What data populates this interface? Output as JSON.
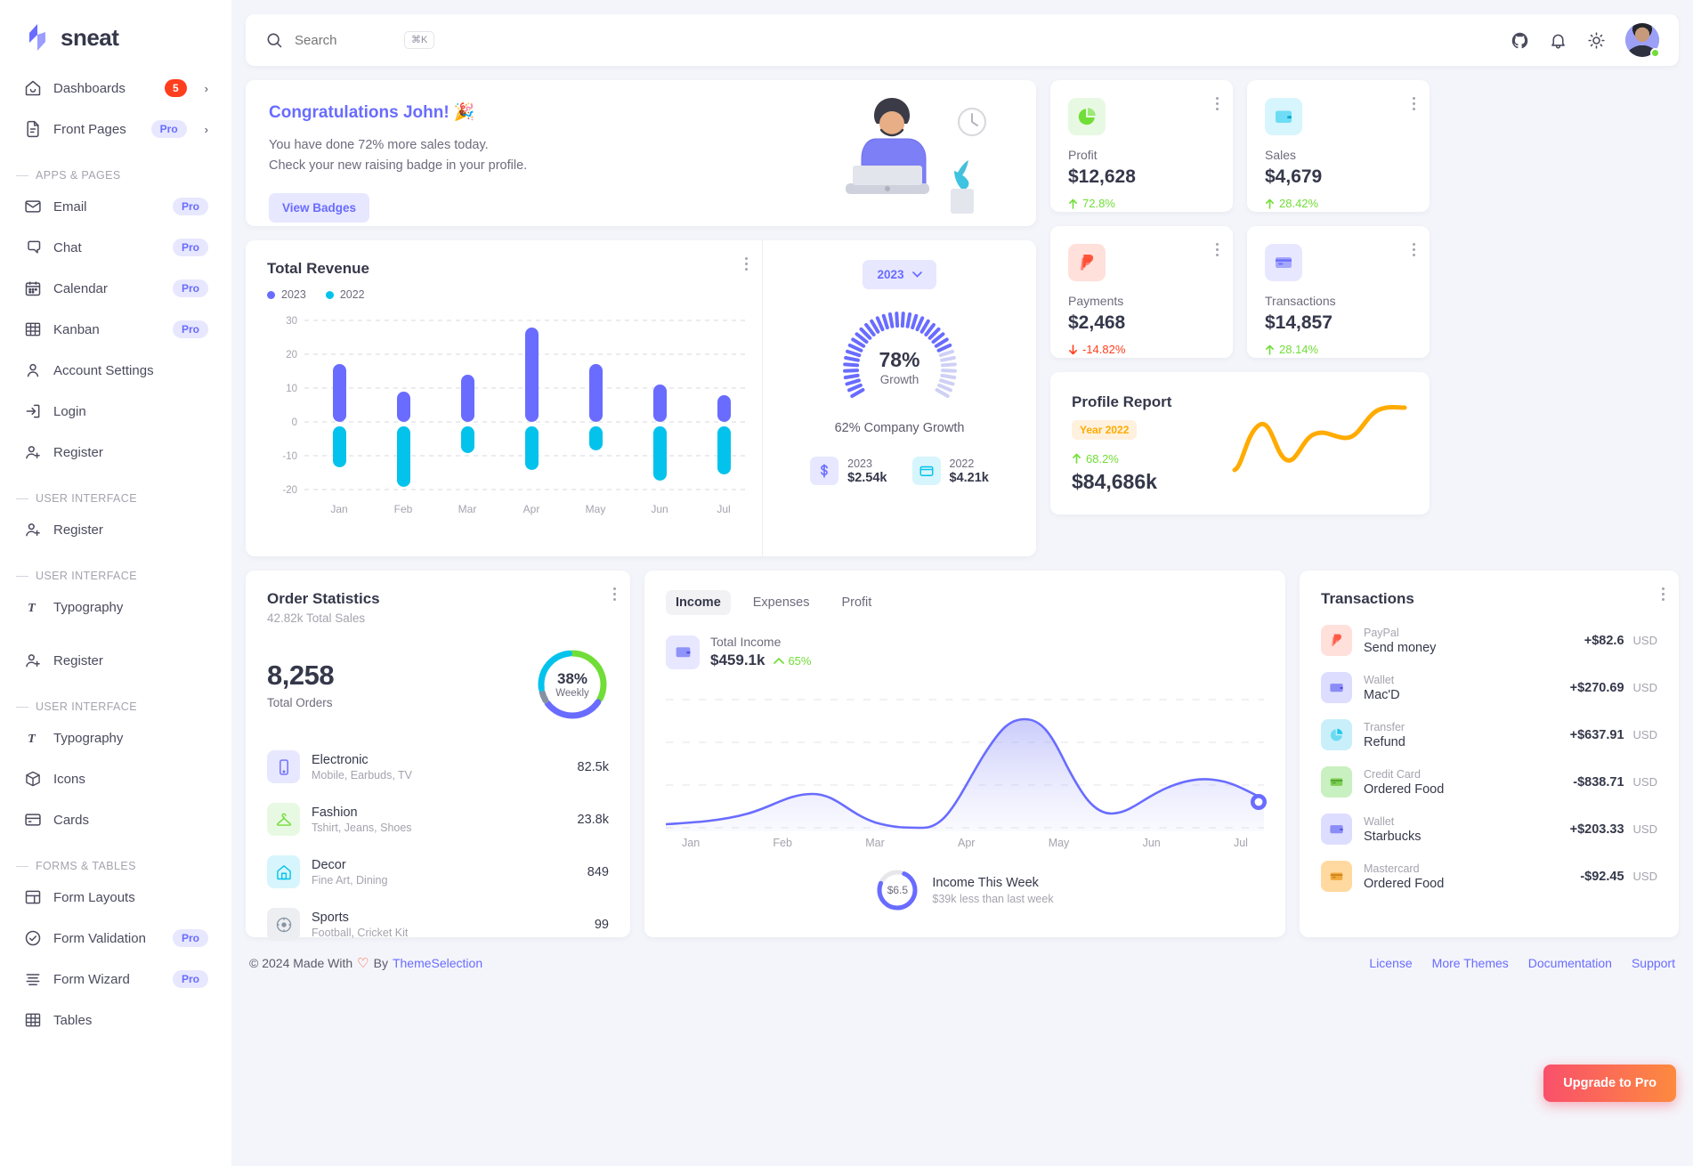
{
  "brand": {
    "name": "sneat"
  },
  "sidebar": {
    "top_items": [
      {
        "label": "Dashboards",
        "icon": "home-icon",
        "badge": "5",
        "chevron": "›"
      },
      {
        "label": "Front Pages",
        "icon": "file-icon",
        "pro": "Pro",
        "chevron": "›"
      }
    ],
    "sections": [
      {
        "title": "APPS & PAGES",
        "items": [
          {
            "label": "Email",
            "icon": "mail-icon",
            "pro": "Pro"
          },
          {
            "label": "Chat",
            "icon": "chat-icon",
            "pro": "Pro"
          },
          {
            "label": "Calendar",
            "icon": "calendar-icon",
            "pro": "Pro"
          },
          {
            "label": "Kanban",
            "icon": "kanban-icon",
            "pro": "Pro"
          },
          {
            "label": "Account Settings",
            "icon": "user-icon"
          },
          {
            "label": "Login",
            "icon": "login-icon"
          },
          {
            "label": "Register",
            "icon": "user-plus-icon"
          }
        ]
      },
      {
        "title": "USER INTERFACE",
        "items": [
          {
            "label": "Register",
            "icon": "user-plus-icon"
          }
        ]
      },
      {
        "title": "USER INTERFACE",
        "items": [
          {
            "label": "Typography",
            "icon": "typography-icon"
          },
          {
            "label": "Register",
            "icon": "user-plus-icon"
          }
        ]
      },
      {
        "title": "USER INTERFACE",
        "items": [
          {
            "label": "Typography",
            "icon": "typography-icon"
          },
          {
            "label": "Icons",
            "icon": "box-icon"
          },
          {
            "label": "Cards",
            "icon": "card-icon"
          }
        ]
      },
      {
        "title": "FORMS & TABLES",
        "items": [
          {
            "label": "Form Layouts",
            "icon": "layout-icon"
          },
          {
            "label": "Form Validation",
            "icon": "check-circle-icon",
            "pro": "Pro"
          },
          {
            "label": "Form Wizard",
            "icon": "wizard-icon",
            "pro": "Pro"
          },
          {
            "label": "Tables",
            "icon": "table-icon"
          }
        ]
      }
    ]
  },
  "topbar": {
    "search_placeholder": "Search",
    "search_value": "",
    "shortcut": "⌘K",
    "icons": [
      "github-icon",
      "bell-icon",
      "sun-icon"
    ]
  },
  "congrats": {
    "title": "Congratulations John! 🎉",
    "line1": "You have done 72% more sales today.",
    "line2": "Check your new raising badge in your profile.",
    "button": "View Badges"
  },
  "stats": [
    {
      "label": "Profit",
      "value": "$12,628",
      "delta": "72.8%",
      "dir": "up",
      "icon": "pie-chart-icon",
      "bg": "#e8f9e3",
      "fg": "#71dd37"
    },
    {
      "label": "Sales",
      "value": "$4,679",
      "delta": "28.42%",
      "dir": "up",
      "icon": "wallet-icon",
      "bg": "#d7f5fc",
      "fg": "#03c3ec"
    },
    {
      "label": "Payments",
      "value": "$2,468",
      "delta": "-14.82%",
      "dir": "down",
      "icon": "paypal-icon",
      "bg": "#ffe0db",
      "fg": "#ff3e1d"
    },
    {
      "label": "Transactions",
      "value": "$14,857",
      "delta": "28.14%",
      "dir": "up",
      "icon": "credit-card-icon",
      "bg": "#e7e7ff",
      "fg": "#696cff"
    }
  ],
  "revenue": {
    "title": "Total Revenue",
    "legend": [
      {
        "label": "2023",
        "color": "#696cff"
      },
      {
        "label": "2022",
        "color": "#03c3ec"
      }
    ],
    "year_selected": "2023",
    "gauge_pct": "78%",
    "gauge_label": "Growth",
    "company_growth": "62% Company Growth",
    "mini": [
      {
        "year": "2023",
        "value": "$2.54k",
        "icon": "dollar-icon",
        "bg": "#e7e7ff",
        "fg": "#696cff"
      },
      {
        "year": "2022",
        "value": "$4.21k",
        "icon": "wallet-icon",
        "bg": "#d7f5fc",
        "fg": "#03c3ec"
      }
    ]
  },
  "profile_report": {
    "title": "Profile Report",
    "year_chip": "Year 2022",
    "delta": "68.2%",
    "value": "$84,686k",
    "line_color": "#ffab00"
  },
  "order_stats": {
    "title": "Order Statistics",
    "subtitle": "42.82k Total Sales",
    "total_orders": "8,258",
    "total_orders_label": "Total Orders",
    "donut_pct": "38%",
    "donut_sub": "Weekly",
    "categories": [
      {
        "name": "Electronic",
        "desc": "Mobile, Earbuds, TV",
        "value": "82.5k",
        "icon": "mobile-icon",
        "bg": "#e7e7ff",
        "fg": "#696cff"
      },
      {
        "name": "Fashion",
        "desc": "Tshirt, Jeans, Shoes",
        "value": "23.8k",
        "icon": "hanger-icon",
        "bg": "#e8f9e3",
        "fg": "#71dd37"
      },
      {
        "name": "Decor",
        "desc": "Fine Art, Dining",
        "value": "849",
        "icon": "home-outline-icon",
        "bg": "#d7f5fc",
        "fg": "#03c3ec"
      },
      {
        "name": "Sports",
        "desc": "Football, Cricket Kit",
        "value": "99",
        "icon": "ball-icon",
        "bg": "#eceef1",
        "fg": "#8592a3"
      }
    ]
  },
  "income": {
    "tabs": [
      {
        "label": "Income",
        "active": true
      },
      {
        "label": "Expenses",
        "active": false
      },
      {
        "label": "Profit",
        "active": false
      }
    ],
    "total_label": "Total Income",
    "total_value": "$459.1k",
    "total_pct": "65%",
    "months": [
      "Jan",
      "Feb",
      "Mar",
      "Apr",
      "May",
      "Jun",
      "Jul"
    ],
    "week_ring_value": "$6.5",
    "week_title": "Income This Week",
    "week_sub": "$39k less than last week"
  },
  "transactions": {
    "title": "Transactions",
    "items": [
      {
        "type": "PayPal",
        "name": "Send money",
        "amount": "+$82.6",
        "currency": "USD",
        "icon": "paypal-icon",
        "bg": "#ffe0db",
        "fg": "#ff5b47"
      },
      {
        "type": "Wallet",
        "name": "Mac'D",
        "amount": "+$270.69",
        "currency": "USD",
        "icon": "wallet-icon",
        "bg": "#ddddff",
        "fg": "#5f61e6"
      },
      {
        "type": "Transfer",
        "name": "Refund",
        "amount": "+$637.91",
        "currency": "USD",
        "icon": "pie-chart-icon",
        "bg": "#c9f0fa",
        "fg": "#1fc8ec"
      },
      {
        "type": "Credit Card",
        "name": "Ordered Food",
        "amount": "-$838.71",
        "currency": "USD",
        "icon": "credit-card-icon",
        "bg": "#c9f0c0",
        "fg": "#5fc63a"
      },
      {
        "type": "Wallet",
        "name": "Starbucks",
        "amount": "+$203.33",
        "currency": "USD",
        "icon": "wallet-icon",
        "bg": "#ddddff",
        "fg": "#5f61e6"
      },
      {
        "type": "Mastercard",
        "name": "Ordered Food",
        "amount": "-$92.45",
        "currency": "USD",
        "icon": "credit-card-icon",
        "bg": "#ffd9a0",
        "fg": "#e8860c"
      }
    ]
  },
  "footer": {
    "copyright_pre": "© 2024 Made With",
    "copyright_mid": "By",
    "brand_link": "ThemeSelection",
    "links": [
      "License",
      "More Themes",
      "Documentation",
      "Support"
    ]
  },
  "upgrade_button": "Upgrade to Pro",
  "chart_data": [
    {
      "type": "bar",
      "title": "Total Revenue",
      "categories": [
        "Jan",
        "Feb",
        "Mar",
        "Apr",
        "May",
        "Jun",
        "Jul"
      ],
      "series": [
        {
          "name": "2023",
          "color": "#696cff",
          "values": [
            17,
            9,
            14,
            28,
            17,
            11,
            8
          ]
        },
        {
          "name": "2022",
          "color": "#03c3ec",
          "values": [
            -12,
            -18,
            -8,
            -13,
            -7,
            -16,
            -14
          ]
        }
      ],
      "ylim": [
        -20,
        30
      ],
      "yticks": [
        30,
        20,
        10,
        0,
        -10,
        -20
      ],
      "grid": true,
      "legend": "top-left"
    },
    {
      "type": "radial-gauge",
      "title": "Growth",
      "value": 78,
      "max": 100,
      "label": "78%",
      "sublabel": "Growth",
      "color": "#696cff"
    },
    {
      "type": "line",
      "title": "Profile Report",
      "x": [
        0,
        1,
        2,
        3,
        4,
        5,
        6,
        7
      ],
      "values": [
        10,
        42,
        78,
        30,
        62,
        58,
        54,
        96
      ],
      "color": "#ffab00",
      "grid": false
    },
    {
      "type": "pie",
      "title": "Order Statistics",
      "labels": [
        "Electronic",
        "Fashion",
        "Decor",
        "Sports"
      ],
      "values": [
        38,
        30,
        25,
        7
      ],
      "colors": [
        "#71dd37",
        "#696cff",
        "#8592a3",
        "#03c3ec"
      ],
      "center_label": "38%",
      "center_sub": "Weekly"
    },
    {
      "type": "area",
      "title": "Total Income",
      "categories": [
        "Jan",
        "Feb",
        "Mar",
        "Apr",
        "May",
        "Jun",
        "Jul"
      ],
      "values": [
        8,
        10,
        34,
        14,
        88,
        18,
        60,
        70,
        52
      ],
      "color": "#696cff",
      "ylim": [
        0,
        100
      ],
      "grid": true
    },
    {
      "type": "pie",
      "title": "Income This Week",
      "labels": [
        "This week",
        "Remaining"
      ],
      "values": [
        75,
        25
      ],
      "colors": [
        "#696cff",
        "#e7e7eb"
      ],
      "center_label": "$6.5"
    }
  ]
}
